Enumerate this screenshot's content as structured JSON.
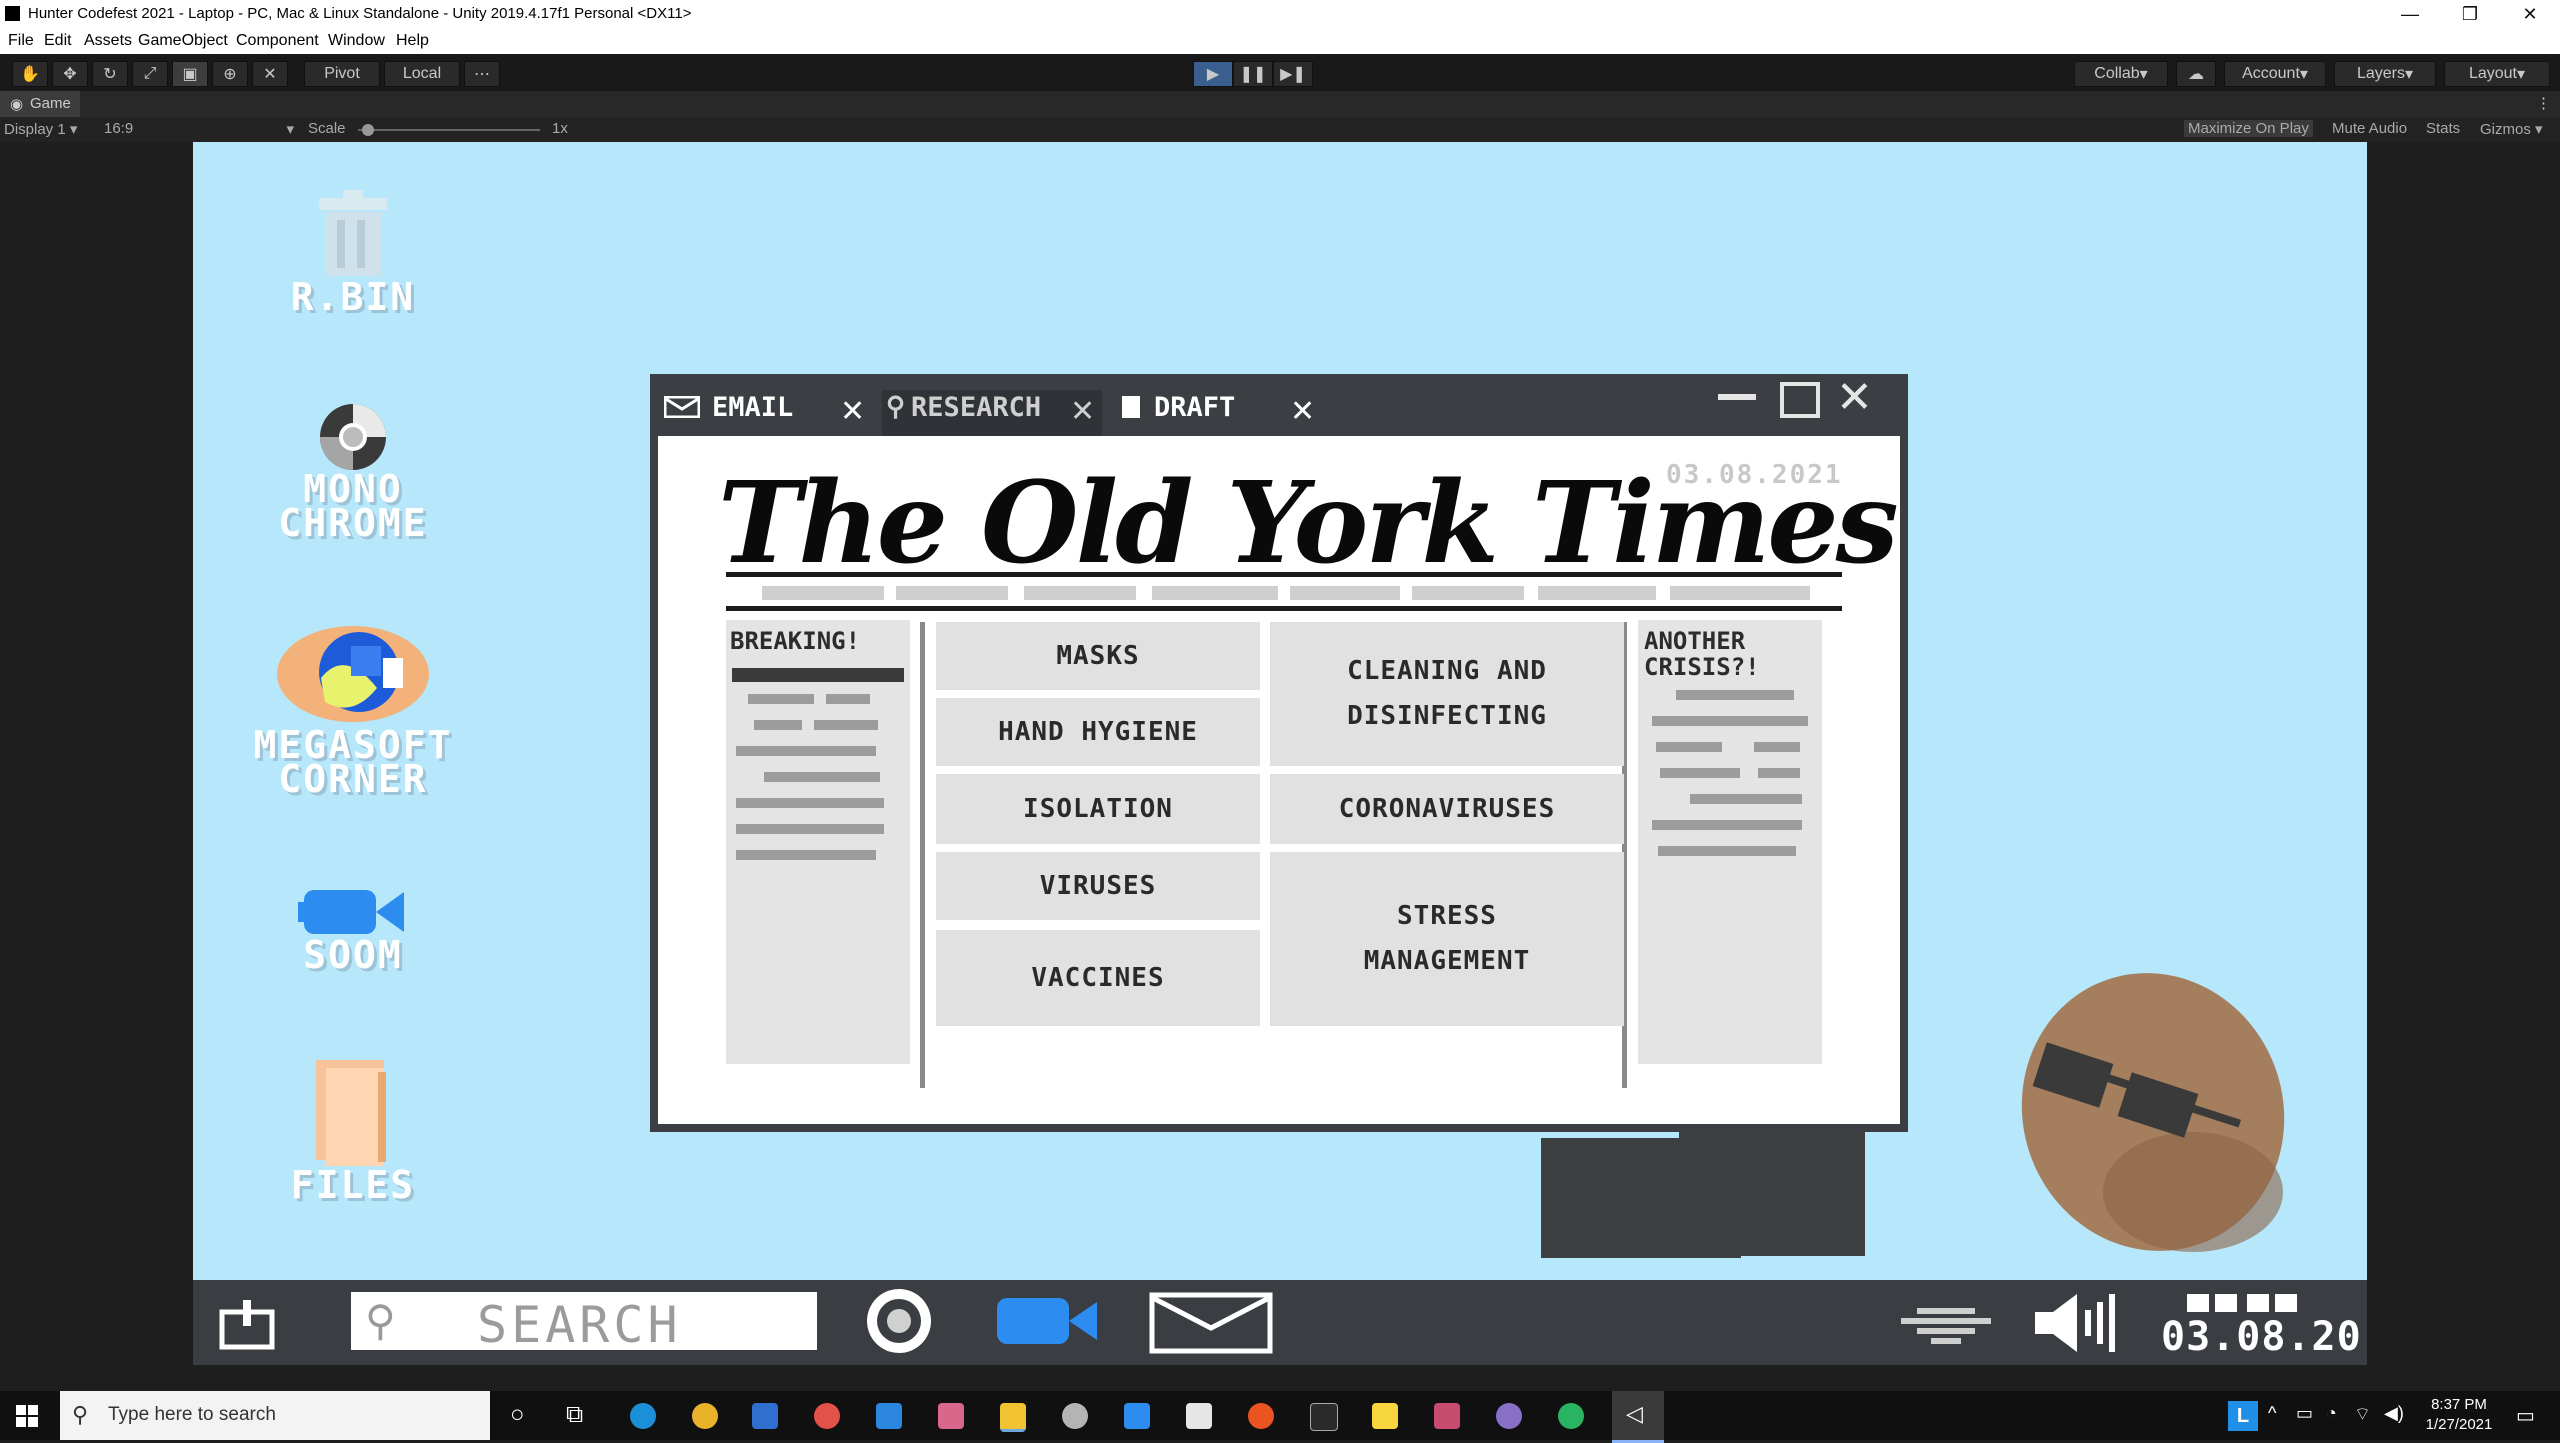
{
  "window": {
    "title": "Hunter Codefest 2021 - Laptop - PC, Mac & Linux Standalone - Unity 2019.4.17f1 Personal <DX11>",
    "controls": [
      "—",
      "❐",
      "✕"
    ]
  },
  "menubar": [
    "File",
    "Edit",
    "Assets",
    "GameObject",
    "Component",
    "Window",
    "Help"
  ],
  "toolbar": {
    "pivot": "Pivot",
    "local": "Local",
    "collab": "Collab",
    "account": "Account",
    "layers": "Layers",
    "layout": "Layout"
  },
  "game_view": {
    "tab": "Game",
    "display": "Display 1",
    "aspect": "16:9",
    "scale_label": "Scale",
    "scale_value": "1x",
    "scale_fraction": 0.02,
    "maximize": "Maximize On Play",
    "mute": "Mute Audio",
    "stats": "Stats",
    "gizmos": "Gizmos"
  },
  "desktop_icons": [
    {
      "label": "R.BIN",
      "icon": "trash-bin-icon"
    },
    {
      "label": "MONO\nCHROME",
      "icon": "monochrome-browser-icon"
    },
    {
      "label": "MEGASOFT\nCORNER",
      "icon": "megasoft-corner-icon"
    },
    {
      "label": "SOOM",
      "icon": "soom-camera-icon"
    },
    {
      "label": "FILES",
      "icon": "folder-icon"
    }
  ],
  "app": {
    "tabs": [
      {
        "label": "EMAIL",
        "icon": "email-icon"
      },
      {
        "label": "RESEARCH",
        "icon": "search-icon"
      },
      {
        "label": "DRAFT",
        "icon": "document-icon"
      }
    ],
    "newspaper": {
      "masthead": "The Old York Times",
      "date": "03.08.2021",
      "left_column_heading": "BREAKING!",
      "right_column_heading": "ANOTHER\nCRISIS?!",
      "topics": [
        "MASKS",
        "HAND HYGIENE",
        "ISOLATION",
        "VIRUSES",
        "VACCINES",
        "CLEANING AND DISINFECTING",
        "CORONAVIRUSES",
        "STRESS MANAGEMENT"
      ]
    }
  },
  "game_taskbar": {
    "search_placeholder": "SEARCH",
    "clock": "03.08.20"
  },
  "windows_taskbar": {
    "search_placeholder": "Type here to search",
    "time": "8:37 PM",
    "date": "1/27/2021"
  },
  "colors": {
    "desktop_bg": "#b6e7fb",
    "window_frame": "#3b3f44",
    "topic_box": "#e1e1e1"
  }
}
